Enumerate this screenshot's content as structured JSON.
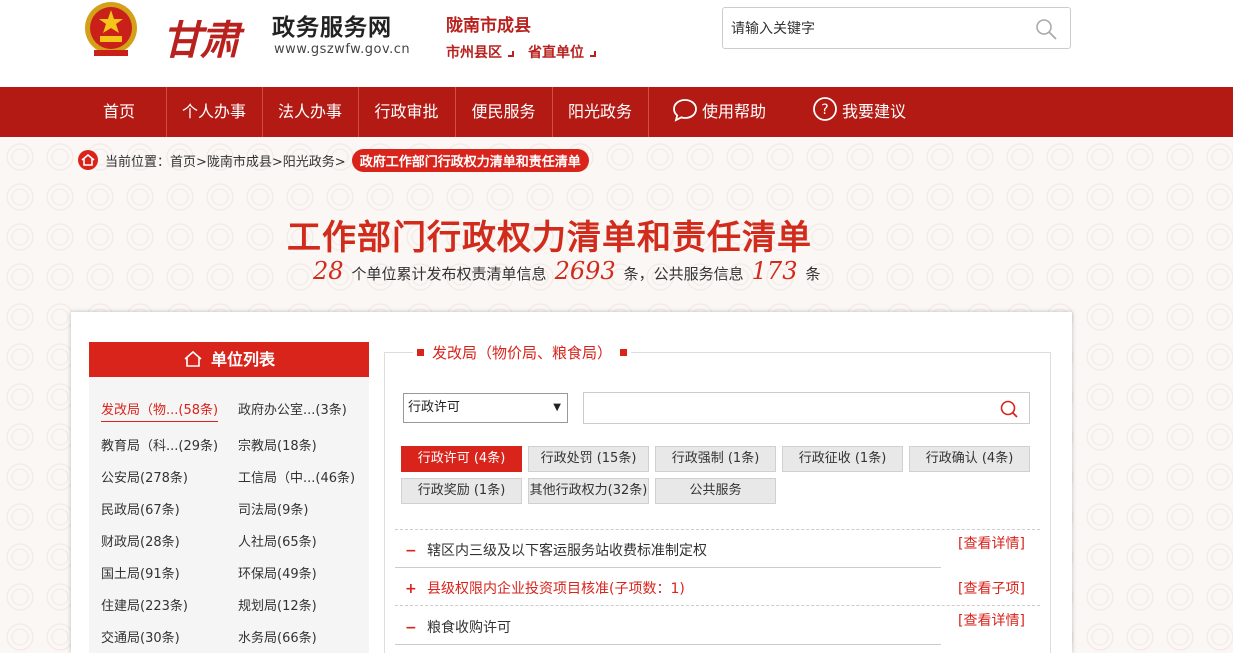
{
  "header": {
    "logo_text": "甘肃",
    "site_name": "政务服务网",
    "site_url": "www.gszwfw.gov.cn",
    "region_title": "陇南市成县",
    "region_links": [
      "市州县区",
      "省直单位"
    ],
    "search_placeholder": "请输入关键字"
  },
  "nav": {
    "items": [
      "首页",
      "个人办事",
      "法人办事",
      "行政审批",
      "便民服务",
      "阳光政务",
      "使用帮助",
      "我要建议"
    ]
  },
  "breadcrumb": {
    "label": "当前位置：",
    "path": "首页>陇南市成县>阳光政务>",
    "current": "政府工作部门行政权力清单和责任清单"
  },
  "page_title": "工作部门行政权力清单和责任清单",
  "stats": {
    "units": "28",
    "units_text": "个单位累计发布权责清单信息",
    "items": "2693",
    "items_text": "条，公共服务信息",
    "services": "173",
    "services_text": "条"
  },
  "unit_list": {
    "title": "单位列表",
    "units": [
      "发改局（物...(58条)",
      "政府办公室...(3条)",
      "教育局（科...(29条)",
      "宗教局(18条)",
      "公安局(278条)",
      "工信局（中...(46条)",
      "民政局(67条)",
      "司法局(9条)",
      "财政局(28条)",
      "人社局(65条)",
      "国土局(91条)",
      "环保局(49条)",
      "住建局(223条)",
      "规划局(12条)",
      "交通局(30条)",
      "水务局(66条)"
    ]
  },
  "section": {
    "title": "发改局（物价局、粮食局）",
    "select_value": "行政许可",
    "tabs": [
      "行政许可 (4条)",
      "行政处罚 (15条)",
      "行政强制 (1条)",
      "行政征收 (1条)",
      "行政确认 (4条)",
      "行政奖励 (1条)",
      "其他行政权力(32条)",
      "公共服务"
    ],
    "rows": [
      {
        "sign": "−",
        "text": "辖区内三级及以下客运服务站收费标准制定权",
        "link": "[查看详情]"
      },
      {
        "sign": "+",
        "text": "县级权限内企业投资项目核准(子项数：1)",
        "link": "[查看子项]"
      },
      {
        "sign": "−",
        "text": "粮食收购许可",
        "link": "[查看详情]"
      }
    ]
  },
  "colors": {
    "brand_red": "#b31a14",
    "accent_red": "#d9241c"
  }
}
